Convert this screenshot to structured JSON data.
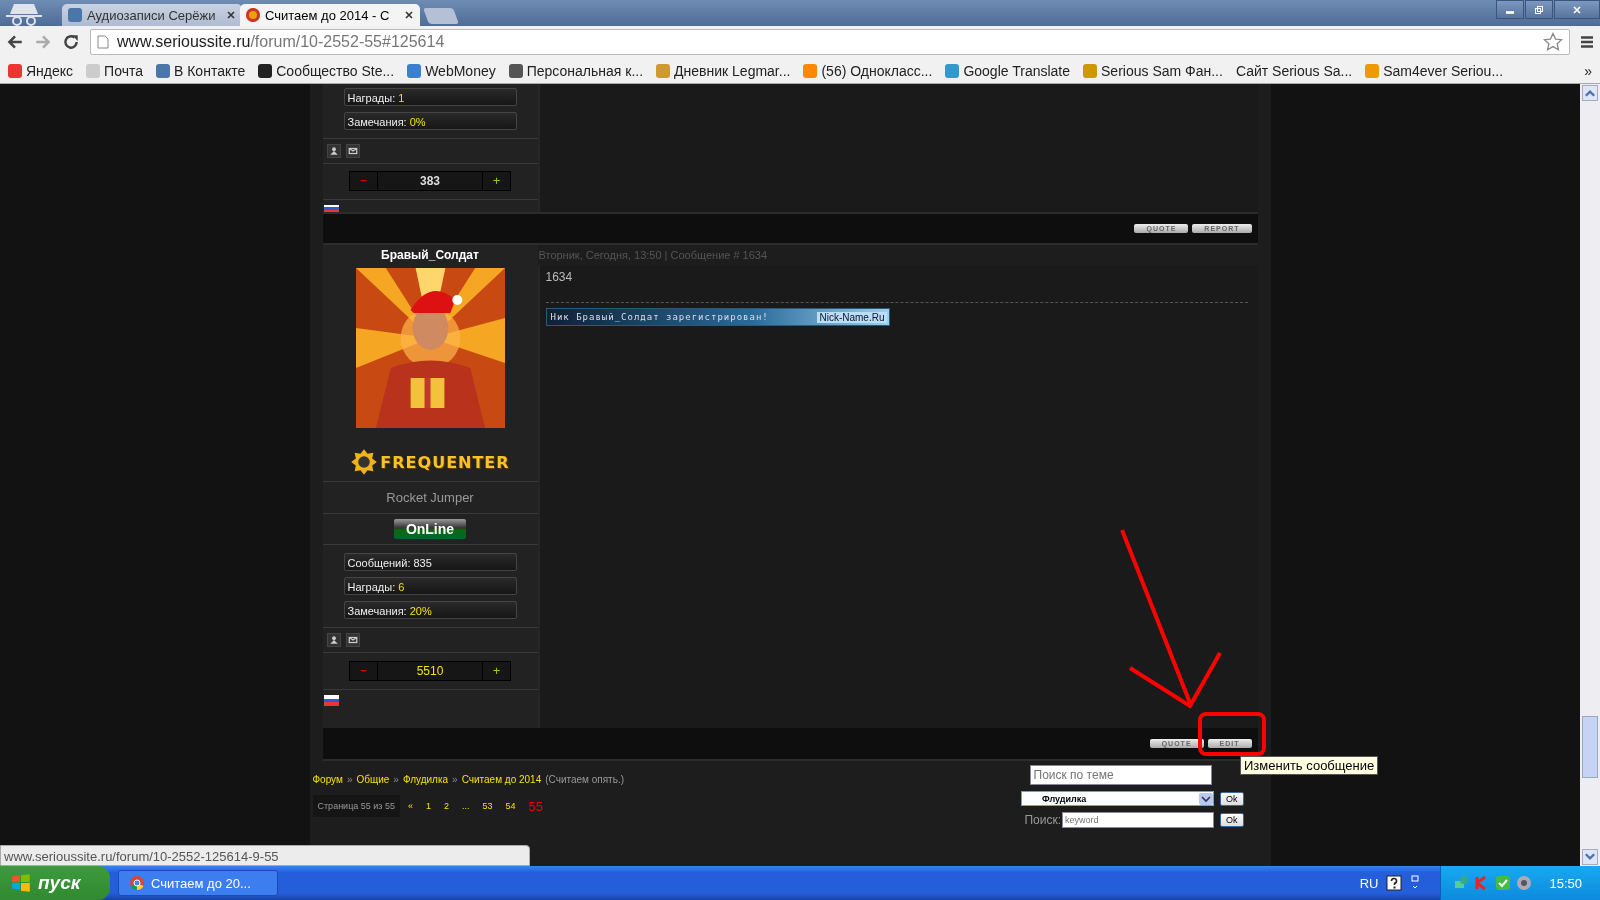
{
  "browser": {
    "tabs": [
      {
        "title": "Аудиозаписи Серёжи",
        "selected": false
      },
      {
        "title": "Считаем до 2014 - С",
        "selected": true
      }
    ],
    "url": {
      "host": "www.serioussite.ru",
      "path": "/forum/10-2552-55#125614"
    },
    "bookmarks": [
      {
        "label": "Яндекс",
        "icon": true
      },
      {
        "label": "Почта",
        "icon": true
      },
      {
        "label": "В Контакте",
        "icon": true
      },
      {
        "label": "Сообщество Ste...",
        "icon": true
      },
      {
        "label": "WebMoney",
        "icon": true
      },
      {
        "label": "Персональная к...",
        "icon": true
      },
      {
        "label": "Дневник Legmar...",
        "icon": true
      },
      {
        "label": "(56) Однокласс...",
        "icon": true
      },
      {
        "label": "Google Translate",
        "icon": true
      },
      {
        "label": "Serious Sam Фан...",
        "icon": true
      },
      {
        "label": "Сайт Serious Sa...",
        "icon": false
      },
      {
        "label": "Sam4ever Seriou...",
        "icon": true
      }
    ],
    "bookmarks_more": "»"
  },
  "previous_post": {
    "stats": [
      {
        "label": "Награды:",
        "value": "1"
      },
      {
        "label": "Замечания:",
        "value": "0%"
      }
    ],
    "rating": {
      "minus": "−",
      "value": "383",
      "plus": "+"
    },
    "buttons": [
      "QUOTE",
      "REPORT"
    ]
  },
  "post": {
    "author": "Бравый_Солдат",
    "meta": "Вторник, Сегодня, 13:50 | Сообщение # 1634",
    "text": "1634",
    "group_badge": "FREQUENTER",
    "rank": "Rocket Jumper",
    "status": "OnLine",
    "stats": [
      {
        "label": "Сообщений:",
        "value": "835",
        "highlight": false
      },
      {
        "label": "Награды:",
        "value": "6",
        "highlight": true
      },
      {
        "label": "Замечания:",
        "value": "20%",
        "highlight": true
      }
    ],
    "rating": {
      "minus": "−",
      "value": "5510",
      "plus": "+"
    },
    "signature": {
      "text": "Ник Бравый_Солдат зарегистрирован!",
      "site": "Nick-Name.Ru"
    },
    "buttons": [
      "QUOTE",
      "EDIT"
    ],
    "tooltip": "Изменить сообщение"
  },
  "footer": {
    "breadcrumbs": [
      "Форум",
      "Общие",
      "Флудилка",
      "Считаем до 2014"
    ],
    "separator": "»",
    "topic_note": "(Считаем опять.)",
    "page_label": "Страница 55 из 55",
    "pages": [
      {
        "label": "«",
        "selected": false
      },
      {
        "label": "1",
        "selected": false
      },
      {
        "label": "2",
        "selected": false
      },
      {
        "label": "...",
        "selected": false
      },
      {
        "label": "53",
        "selected": false
      },
      {
        "label": "54",
        "selected": false
      },
      {
        "label": "55",
        "selected": true
      }
    ],
    "topic_search": {
      "placeholder": "Поиск по теме"
    },
    "forum_select": {
      "value": "Флудилка",
      "button": "Ok"
    },
    "search": {
      "label": "Поиск:",
      "placeholder": "keyword",
      "button": "Ok"
    }
  },
  "status_url": "www.serioussite.ru/forum/10-2552-125614-9-55",
  "taskbar": {
    "start": "пуск",
    "task": "Считаем до 20...",
    "language": "RU",
    "clock": "15:50"
  }
}
